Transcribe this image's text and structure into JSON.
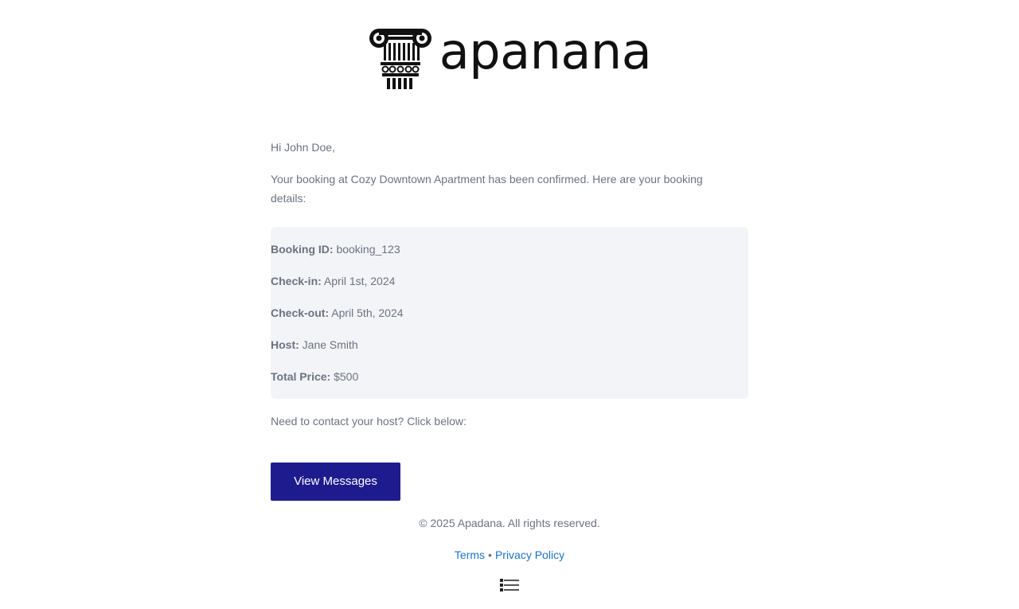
{
  "brand": {
    "name": "apanana",
    "logo_icon": "ionic-column-capital-icon"
  },
  "email": {
    "greeting": "Hi John Doe,",
    "intro": "Your booking at Cozy Downtown Apartment has been confirmed. Here are your booking details:",
    "details": [
      {
        "label": "Booking ID:",
        "value": "booking_123"
      },
      {
        "label": "Check-in:",
        "value": "April 1st, 2024"
      },
      {
        "label": "Check-out:",
        "value": "April 5th, 2024"
      },
      {
        "label": "Host:",
        "value": "Jane Smith"
      },
      {
        "label": "Total Price:",
        "value": "$500"
      }
    ],
    "contact_prompt": "Need to contact your host? Click below:",
    "button_label": "View Messages"
  },
  "footer": {
    "copyright": "© 2025 Apadana. All rights reserved.",
    "terms_label": "Terms",
    "separator": "•",
    "privacy_label": "Privacy Policy"
  },
  "colors": {
    "button_bg": "#1e1b8e",
    "link": "#1a73c8",
    "details_bg": "#f3f4f8",
    "text": "#6b7280"
  }
}
